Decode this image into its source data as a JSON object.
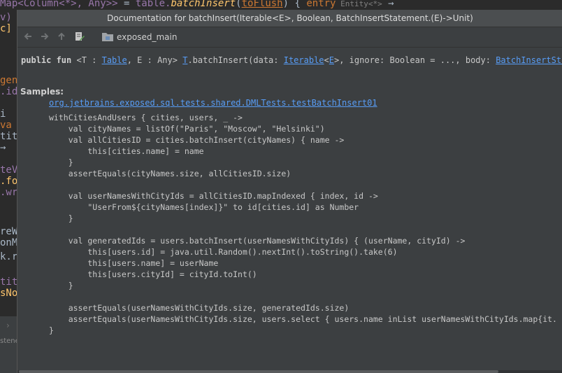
{
  "editor": {
    "topline": [
      "Map<Column<*>, Any>>",
      " = ",
      "table.",
      "batchInsert",
      "(",
      "toFlush",
      ") { ",
      "entry",
      " Entity<*>",
      "  →"
    ],
    "left_lines": [
      {
        "text": "v)",
        "color": "#9876aa"
      },
      {
        "text": "c]",
        "color": "#ffc66d"
      },
      {
        "text": "gen",
        "color": "#cc7832"
      },
      {
        "text": ".id",
        "color": "#9876aa"
      },
      {
        "text": "i",
        "color": "#a9b7c6"
      },
      {
        "text": " va",
        "color": "#cc7832"
      },
      {
        "text": "tit",
        "color": "#a9b7c6"
      },
      {
        "text": "→",
        "color": "#a9b7c6"
      },
      {
        "text": "teV",
        "color": "#9876aa"
      },
      {
        "text": ".fo",
        "color": "#ffc66d"
      },
      {
        "text": ".wr",
        "color": "#9876aa"
      },
      {
        "text": "reW",
        "color": "#a9b7c6"
      },
      {
        "text": "onM",
        "color": "#a9b7c6"
      },
      {
        "text": "k.r",
        "color": "#a9b7c6"
      },
      {
        "text": "tit",
        "color": "#9876aa"
      },
      {
        "text": "sNo",
        "color": "#ffc66d"
      }
    ],
    "bottom_chevron": "›",
    "bottom_label": "stene"
  },
  "popup": {
    "title": "Documentation for batchInsert(Iterable<E>, Boolean, BatchInsertStatement.(E)->Unit)",
    "toolbar": {
      "back_icon": "back-arrow-icon",
      "forward_icon": "forward-arrow-icon",
      "up_icon": "up-arrow-icon",
      "edit_icon": "edit-source-icon",
      "module_icon": "module-folder-icon",
      "module_name": "exposed_main"
    },
    "signature": {
      "p1": "public fun",
      "p2": " <T : ",
      "table": "Table",
      "p3": ", E : Any> ",
      "t": "T",
      "p4": ".batchInsert(data: ",
      "iterable": "Iterable",
      "p5": "<",
      "e": "E",
      "p6": ">, ignore: Boolean = ..., body: ",
      "statement": "BatchInsertStatement"
    },
    "samples_header": "Samples:",
    "sample_link": "org.jetbrains.exposed.sql.tests.shared.DMLTests.testBatchInsert01",
    "code": [
      "withCitiesAndUsers { cities, users, _ ->",
      "    val cityNames = listOf(\"Paris\", \"Moscow\", \"Helsinki\")",
      "    val allCitiesID = cities.batchInsert(cityNames) { name ->",
      "        this[cities.name] = name",
      "    }",
      "    assertEquals(cityNames.size, allCitiesID.size)",
      "",
      "    val userNamesWithCityIds = allCitiesID.mapIndexed { index, id ->",
      "        \"UserFrom${cityNames[index]}\" to id[cities.id] as Number",
      "    }",
      "",
      "    val generatedIds = users.batchInsert(userNamesWithCityIds) { (userName, cityId) ->",
      "        this[users.id] = java.util.Random().nextInt().toString().take(6)",
      "        this[users.name] = userName",
      "        this[users.cityId] = cityId.toInt()",
      "    }",
      "",
      "    assertEquals(userNamesWithCityIds.size, generatedIds.size)",
      "    assertEquals(userNamesWithCityIds.size, users.select { users.name inList userNamesWithCityIds.map{it.",
      "}"
    ]
  }
}
